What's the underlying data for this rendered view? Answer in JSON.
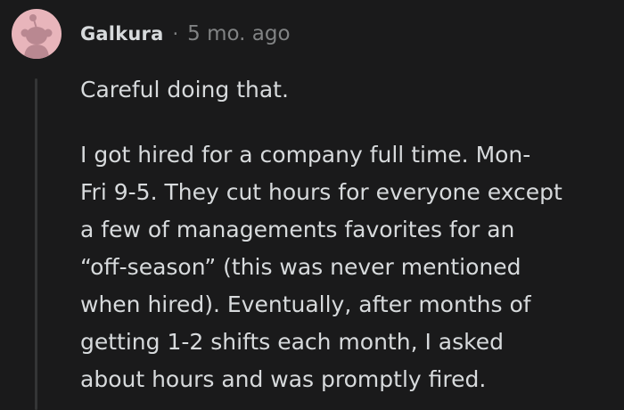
{
  "colors": {
    "background": "#1a1a1b",
    "text": "#d7dadc",
    "meta": "#818384",
    "thread_line": "#343536",
    "avatar_bg": "#e8b5bb",
    "avatar_fg": "#b98891"
  },
  "icons": {
    "avatar": "snoo-avatar-icon"
  },
  "comment": {
    "author": "Galkura",
    "separator": "·",
    "timestamp": "5 mo. ago",
    "paragraph1": [
      "Careful doing that."
    ],
    "paragraph2": [
      "I got hired for a company full time. Mon-",
      "Fri 9-5. They cut hours for everyone except",
      "a few of managements favorites for an",
      "“off-season” (this was never mentioned",
      "when hired). Eventually, after months of",
      "getting 1-2 shifts each month, I asked",
      "about hours and was promptly fired."
    ]
  }
}
